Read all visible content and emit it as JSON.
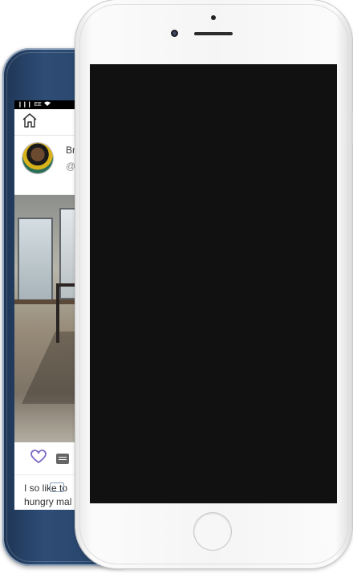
{
  "back_phone": {
    "status_bar": {
      "signal": "❙❙❙",
      "carrier": "EE",
      "wifi": "wifi-icon"
    },
    "post": {
      "name": "Br",
      "handle": "@",
      "caption": "I so like to \nhungry mal\nparties a"
    }
  },
  "front_phone": {
    "screen_state": "blank"
  },
  "colors": {
    "heart": "#7b68c4",
    "back_phone_body": "#2e4d76",
    "front_screen": "#111111"
  }
}
